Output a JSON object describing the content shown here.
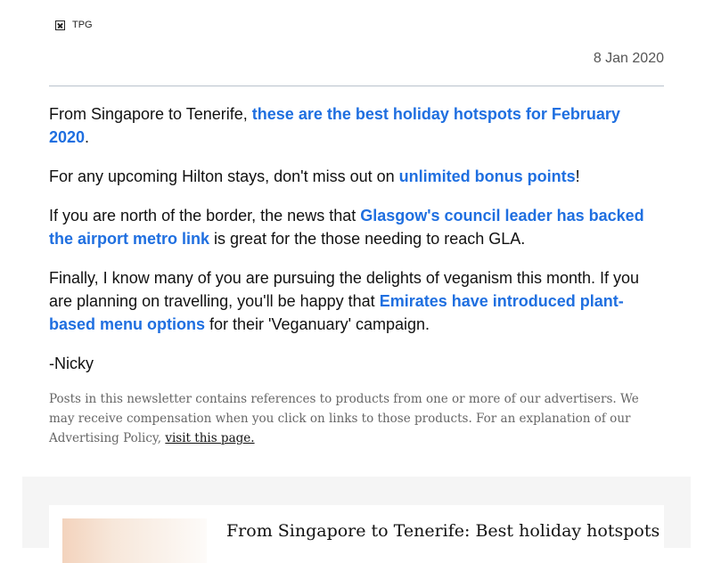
{
  "header": {
    "logo_alt": "TPG"
  },
  "date": "8 Jan 2020",
  "paragraphs": {
    "p1": {
      "pre": "From Singapore to Tenerife, ",
      "link": "these are the best holiday hotspots for February 2020",
      "post": "."
    },
    "p2": {
      "pre": "For any upcoming Hilton stays, don't miss out on ",
      "link": "unlimited bonus points",
      "post": "!"
    },
    "p3": {
      "pre": "If you are north of the border, the news that ",
      "link": "Glasgow's council leader has backed the airport metro link",
      "post": " is great for the those needing to reach GLA."
    },
    "p4": {
      "pre": "Finally, I know many of you are pursuing the delights of veganism this month.  If you are planning on travelling, you'll be happy that ",
      "link": "Emirates have introduced plant-based menu options",
      "post": " for their 'Veganuary' campaign."
    }
  },
  "signoff": "-Nicky",
  "disclaimer": {
    "text": "Posts in this newsletter contains references to products from one or more of our advertisers. We may receive compensation when you click on links to those products. For an explanation of our Advertising Policy, ",
    "link": "visit this page."
  },
  "teaser": {
    "title": "From Singapore to Tenerife: Best holiday hotspots"
  },
  "colors": {
    "link": "#1f6fe0",
    "muted": "#555555",
    "rule": "#b8c2cc",
    "teaser_bg": "#f5f5f5"
  }
}
